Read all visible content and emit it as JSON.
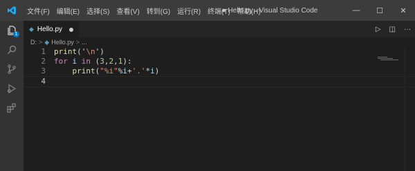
{
  "window": {
    "title": "● Hello.py - Visual Studio Code",
    "menu": [
      "文件(F)",
      "编辑(E)",
      "选择(S)",
      "查看(V)",
      "转到(G)",
      "运行(R)",
      "终端(T)",
      "帮助(H)"
    ],
    "controls": {
      "minimize": "—",
      "maximize": "☐",
      "close": "✕"
    }
  },
  "activity": {
    "explorer_badge": "1"
  },
  "tabs": [
    {
      "label": "Hello.py",
      "icon": "python-icon",
      "modified": true
    }
  ],
  "breadcrumb": {
    "drive": "D:",
    "sep1": ">",
    "file_icon": "python-icon",
    "file": "Hello.py",
    "sep2": ">",
    "more": "..."
  },
  "editor": {
    "lines": [
      {
        "num": "1",
        "tokens": [
          {
            "t": "print",
            "c": "fn"
          },
          {
            "t": "('",
            "c": "op"
          },
          {
            "t": "\\n",
            "c": "str"
          },
          {
            "t": "')",
            "c": "op"
          }
        ]
      },
      {
        "num": "2",
        "tokens": [
          {
            "t": "for",
            "c": "kw"
          },
          {
            "t": " ",
            "c": "op"
          },
          {
            "t": "i",
            "c": "var"
          },
          {
            "t": " ",
            "c": "op"
          },
          {
            "t": "in",
            "c": "kw"
          },
          {
            "t": " (",
            "c": "op"
          },
          {
            "t": "3",
            "c": "num"
          },
          {
            "t": ",",
            "c": "op"
          },
          {
            "t": "2",
            "c": "num"
          },
          {
            "t": ",",
            "c": "op"
          },
          {
            "t": "1",
            "c": "num"
          },
          {
            "t": "):",
            "c": "op"
          }
        ]
      },
      {
        "num": "3",
        "tokens": [
          {
            "t": "    ",
            "c": "op"
          },
          {
            "t": "print",
            "c": "fn"
          },
          {
            "t": "(",
            "c": "op"
          },
          {
            "t": "\"%i\"",
            "c": "str"
          },
          {
            "t": "%",
            "c": "op"
          },
          {
            "t": "i",
            "c": "var"
          },
          {
            "t": "+",
            "c": "op"
          },
          {
            "t": "'.'",
            "c": "str"
          },
          {
            "t": "*",
            "c": "op"
          },
          {
            "t": "i",
            "c": "var"
          },
          {
            "t": ")",
            "c": "op"
          }
        ]
      },
      {
        "num": "4",
        "tokens": []
      }
    ],
    "current_line": "4"
  },
  "colors": {
    "accent": "#007acc",
    "titlebar": "#3c3c3c",
    "editor_bg": "#1e1e1e",
    "activitybar": "#333333"
  }
}
